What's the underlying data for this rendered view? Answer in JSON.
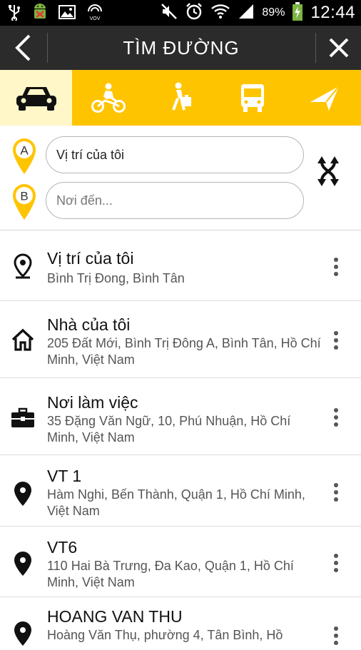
{
  "status_bar": {
    "battery_percent": "89%",
    "time": "12:44",
    "left_icons": [
      "usb-icon",
      "android-icon",
      "image-icon",
      "vov-icon"
    ],
    "right_icons": [
      "mute-icon",
      "alarm-icon",
      "wifi-icon",
      "signal-icon",
      "battery-icon"
    ],
    "vov_label": "VOV"
  },
  "header": {
    "title": "TÌM ĐƯỜNG"
  },
  "modes": [
    {
      "name": "car",
      "active": true
    },
    {
      "name": "motorbike",
      "active": false
    },
    {
      "name": "walk",
      "active": false
    },
    {
      "name": "bus",
      "active": false
    },
    {
      "name": "navigate",
      "active": false
    }
  ],
  "route": {
    "start_label": "A",
    "end_label": "B",
    "start_value": "Vị trí của tôi",
    "end_placeholder": "Nơi đến..."
  },
  "places": [
    {
      "icon": "location-target-icon",
      "name": "Vị trí của tôi",
      "address": "Bình Trị Đong, Bình Tân"
    },
    {
      "icon": "home-icon",
      "name": "Nhà của tôi",
      "address": "205 Đất Mới, Bình Trị Đông A, Bình Tân, Hồ Chí Minh, Việt Nam"
    },
    {
      "icon": "briefcase-icon",
      "name": "Nơi làm việc",
      "address": "35 Đặng Văn Ngữ, 10, Phú Nhuận, Hồ Chí Minh, Việt Nam"
    },
    {
      "icon": "pin-icon",
      "name": "VT 1",
      "address": "Hàm Nghi, Bến Thành, Quận 1, Hồ Chí Minh, Việt Nam"
    },
    {
      "icon": "pin-icon",
      "name": "VT6",
      "address": "110 Hai Bà Trưng, Đa Kao, Quận 1, Hồ Chí Minh, Việt Nam"
    },
    {
      "icon": "pin-icon",
      "name": "HOANG VAN THU",
      "address": "Hoàng Văn Thụ, phường 4, Tân Bình, Hồ"
    }
  ],
  "colors": {
    "accent": "#ffc400",
    "header": "#2b2b2b",
    "active_mode": "#fff7c8"
  }
}
